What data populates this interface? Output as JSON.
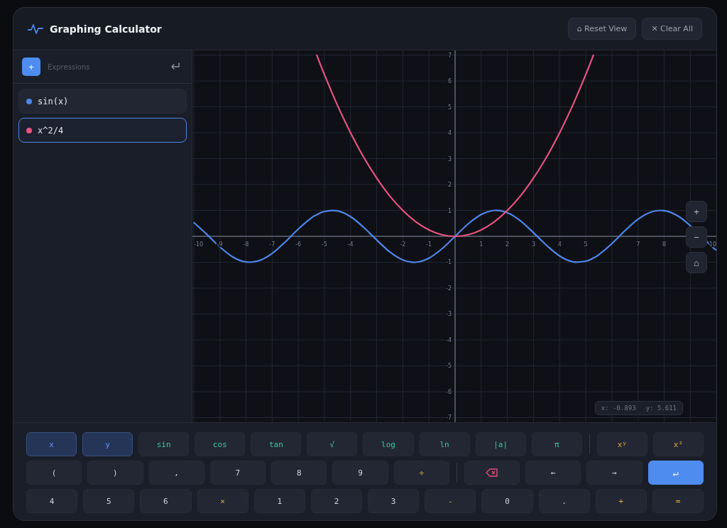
{
  "window": {
    "title": "Graphing Calculator"
  },
  "header_buttons": [
    {
      "label": "⌂ Reset View"
    },
    {
      "label": "✕ Clear All"
    }
  ],
  "sidebar": {
    "input": {
      "placeholder": "Expressions"
    },
    "add_button": "+",
    "expressions": [
      {
        "text": "sin(x)",
        "color": "#4f86e8",
        "selected": false
      },
      {
        "text": "x^2/4",
        "color": "#e8537f",
        "selected": true
      }
    ]
  },
  "graph": {
    "chart_data": {
      "type": "line",
      "xlim": [
        -10.05,
        10.05
      ],
      "ylim": [
        -7.18,
        7.18
      ],
      "grid": true,
      "xticks": [
        -10,
        -9,
        -8,
        -7,
        -6,
        -5,
        -4,
        -2,
        -1,
        1,
        2,
        3,
        4,
        5,
        7,
        8,
        10
      ],
      "yticks": [
        -7,
        -6,
        -5,
        -4,
        -3,
        -2,
        -1,
        1,
        2,
        3,
        4,
        5,
        6,
        7
      ],
      "x": [
        -10,
        -9.5,
        -9,
        -8.5,
        -8,
        -7.5,
        -7,
        -6.5,
        -6,
        -5.5,
        -5.3,
        -5,
        -4.5,
        -4,
        -3.5,
        -3,
        -2.5,
        -2,
        -1.5,
        -1,
        -0.5,
        0,
        0.5,
        1,
        1.5,
        2,
        2.5,
        3,
        3.5,
        4,
        4.5,
        5,
        5.3,
        5.5,
        6,
        6.5,
        7,
        7.5,
        8,
        8.5,
        9,
        9.8,
        10
      ],
      "series": [
        {
          "color": "#4f86e8",
          "values": [
            0.54,
            0.08,
            -0.41,
            -0.8,
            -0.99,
            -0.94,
            -0.66,
            -0.22,
            0.28,
            0.71,
            0.83,
            0.96,
            0.98,
            0.76,
            0.35,
            -0.14,
            -0.6,
            -0.91,
            -1,
            -0.84,
            -0.48,
            0,
            0.48,
            0.84,
            1,
            0.91,
            0.6,
            0.14,
            -0.35,
            -0.76,
            -0.98,
            -0.96,
            -0.83,
            -0.71,
            -0.28,
            0.22,
            0.66,
            0.94,
            0.99,
            0.8,
            0.41,
            -0.37,
            -0.54
          ]
        },
        {
          "color": "#e8537f",
          "values": [
            null,
            null,
            null,
            null,
            null,
            null,
            null,
            null,
            null,
            null,
            7.02,
            6.25,
            5.06,
            4,
            3.06,
            2.25,
            1.56,
            1,
            0.56,
            0.25,
            0.06,
            0,
            0.06,
            0.25,
            0.56,
            1,
            1.56,
            2.25,
            3.06,
            4,
            5.06,
            6.25,
            7.02,
            null,
            null,
            null,
            null,
            null,
            null,
            null,
            null,
            null,
            null
          ]
        }
      ]
    },
    "zoom_buttons": [
      {
        "label": "+"
      },
      {
        "label": "−"
      },
      {
        "label": "⌂"
      }
    ],
    "readout": {
      "x": "x: -0.893",
      "y": "y: 5.611"
    }
  },
  "keypad": {
    "rows": [
      {
        "groups": [
          [
            {
              "label": "x",
              "kind": "variable"
            },
            {
              "label": "y",
              "kind": "variable"
            },
            {
              "label": "sin",
              "kind": "function"
            },
            {
              "label": "cos",
              "kind": "function"
            },
            {
              "label": "tan",
              "kind": "function"
            },
            {
              "label": "√",
              "kind": "function"
            },
            {
              "label": "log",
              "kind": "function"
            },
            {
              "label": "ln",
              "kind": "function"
            },
            {
              "label": "|a|",
              "kind": "function"
            },
            {
              "label": "π",
              "kind": "function"
            }
          ],
          [
            {
              "label": "xʸ",
              "kind": "operator"
            },
            {
              "label": "x²",
              "kind": "operator"
            }
          ]
        ]
      },
      {
        "groups": [
          [
            {
              "label": "(",
              "kind": "number"
            },
            {
              "label": ")",
              "kind": "number"
            },
            {
              "label": ",",
              "kind": "number"
            },
            {
              "label": "7",
              "kind": "number"
            },
            {
              "label": "8",
              "kind": "number"
            },
            {
              "label": "9",
              "kind": "number"
            },
            {
              "label": "÷",
              "kind": "operator"
            }
          ],
          [
            {
              "kind": "delete"
            },
            {
              "label": "←",
              "kind": "number"
            },
            {
              "label": "→",
              "kind": "number"
            },
            {
              "label": "↵",
              "kind": "enter"
            }
          ]
        ]
      },
      {
        "groups": [
          [
            {
              "label": "4",
              "kind": "number"
            },
            {
              "label": "5",
              "kind": "number"
            },
            {
              "label": "6",
              "kind": "number"
            },
            {
              "label": "×",
              "kind": "operator"
            },
            {
              "label": "1",
              "kind": "number"
            },
            {
              "label": "2",
              "kind": "number"
            },
            {
              "label": "3",
              "kind": "number"
            },
            {
              "label": "-",
              "kind": "operator"
            },
            {
              "label": "0",
              "kind": "number"
            },
            {
              "label": ".",
              "kind": "number"
            },
            {
              "label": "+",
              "kind": "operator"
            },
            {
              "label": "=",
              "kind": "operator"
            }
          ]
        ]
      }
    ]
  }
}
